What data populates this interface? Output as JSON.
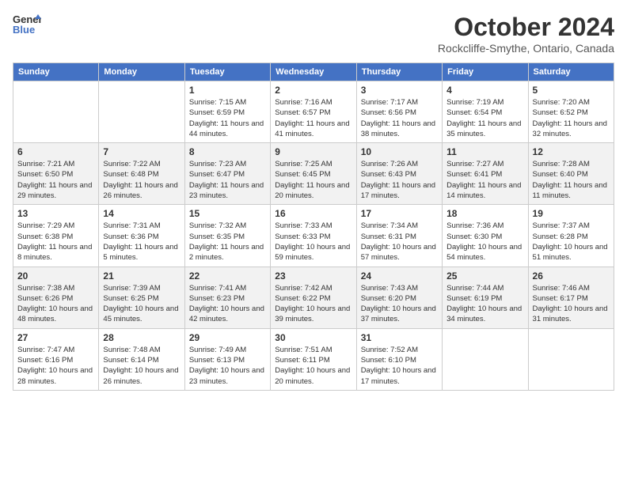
{
  "header": {
    "logo_line1": "General",
    "logo_line2": "Blue",
    "month": "October 2024",
    "location": "Rockcliffe-Smythe, Ontario, Canada"
  },
  "weekdays": [
    "Sunday",
    "Monday",
    "Tuesday",
    "Wednesday",
    "Thursday",
    "Friday",
    "Saturday"
  ],
  "weeks": [
    [
      {
        "day": "",
        "sunrise": "",
        "sunset": "",
        "daylight": ""
      },
      {
        "day": "",
        "sunrise": "",
        "sunset": "",
        "daylight": ""
      },
      {
        "day": "1",
        "sunrise": "Sunrise: 7:15 AM",
        "sunset": "Sunset: 6:59 PM",
        "daylight": "Daylight: 11 hours and 44 minutes."
      },
      {
        "day": "2",
        "sunrise": "Sunrise: 7:16 AM",
        "sunset": "Sunset: 6:57 PM",
        "daylight": "Daylight: 11 hours and 41 minutes."
      },
      {
        "day": "3",
        "sunrise": "Sunrise: 7:17 AM",
        "sunset": "Sunset: 6:56 PM",
        "daylight": "Daylight: 11 hours and 38 minutes."
      },
      {
        "day": "4",
        "sunrise": "Sunrise: 7:19 AM",
        "sunset": "Sunset: 6:54 PM",
        "daylight": "Daylight: 11 hours and 35 minutes."
      },
      {
        "day": "5",
        "sunrise": "Sunrise: 7:20 AM",
        "sunset": "Sunset: 6:52 PM",
        "daylight": "Daylight: 11 hours and 32 minutes."
      }
    ],
    [
      {
        "day": "6",
        "sunrise": "Sunrise: 7:21 AM",
        "sunset": "Sunset: 6:50 PM",
        "daylight": "Daylight: 11 hours and 29 minutes."
      },
      {
        "day": "7",
        "sunrise": "Sunrise: 7:22 AM",
        "sunset": "Sunset: 6:48 PM",
        "daylight": "Daylight: 11 hours and 26 minutes."
      },
      {
        "day": "8",
        "sunrise": "Sunrise: 7:23 AM",
        "sunset": "Sunset: 6:47 PM",
        "daylight": "Daylight: 11 hours and 23 minutes."
      },
      {
        "day": "9",
        "sunrise": "Sunrise: 7:25 AM",
        "sunset": "Sunset: 6:45 PM",
        "daylight": "Daylight: 11 hours and 20 minutes."
      },
      {
        "day": "10",
        "sunrise": "Sunrise: 7:26 AM",
        "sunset": "Sunset: 6:43 PM",
        "daylight": "Daylight: 11 hours and 17 minutes."
      },
      {
        "day": "11",
        "sunrise": "Sunrise: 7:27 AM",
        "sunset": "Sunset: 6:41 PM",
        "daylight": "Daylight: 11 hours and 14 minutes."
      },
      {
        "day": "12",
        "sunrise": "Sunrise: 7:28 AM",
        "sunset": "Sunset: 6:40 PM",
        "daylight": "Daylight: 11 hours and 11 minutes."
      }
    ],
    [
      {
        "day": "13",
        "sunrise": "Sunrise: 7:29 AM",
        "sunset": "Sunset: 6:38 PM",
        "daylight": "Daylight: 11 hours and 8 minutes."
      },
      {
        "day": "14",
        "sunrise": "Sunrise: 7:31 AM",
        "sunset": "Sunset: 6:36 PM",
        "daylight": "Daylight: 11 hours and 5 minutes."
      },
      {
        "day": "15",
        "sunrise": "Sunrise: 7:32 AM",
        "sunset": "Sunset: 6:35 PM",
        "daylight": "Daylight: 11 hours and 2 minutes."
      },
      {
        "day": "16",
        "sunrise": "Sunrise: 7:33 AM",
        "sunset": "Sunset: 6:33 PM",
        "daylight": "Daylight: 10 hours and 59 minutes."
      },
      {
        "day": "17",
        "sunrise": "Sunrise: 7:34 AM",
        "sunset": "Sunset: 6:31 PM",
        "daylight": "Daylight: 10 hours and 57 minutes."
      },
      {
        "day": "18",
        "sunrise": "Sunrise: 7:36 AM",
        "sunset": "Sunset: 6:30 PM",
        "daylight": "Daylight: 10 hours and 54 minutes."
      },
      {
        "day": "19",
        "sunrise": "Sunrise: 7:37 AM",
        "sunset": "Sunset: 6:28 PM",
        "daylight": "Daylight: 10 hours and 51 minutes."
      }
    ],
    [
      {
        "day": "20",
        "sunrise": "Sunrise: 7:38 AM",
        "sunset": "Sunset: 6:26 PM",
        "daylight": "Daylight: 10 hours and 48 minutes."
      },
      {
        "day": "21",
        "sunrise": "Sunrise: 7:39 AM",
        "sunset": "Sunset: 6:25 PM",
        "daylight": "Daylight: 10 hours and 45 minutes."
      },
      {
        "day": "22",
        "sunrise": "Sunrise: 7:41 AM",
        "sunset": "Sunset: 6:23 PM",
        "daylight": "Daylight: 10 hours and 42 minutes."
      },
      {
        "day": "23",
        "sunrise": "Sunrise: 7:42 AM",
        "sunset": "Sunset: 6:22 PM",
        "daylight": "Daylight: 10 hours and 39 minutes."
      },
      {
        "day": "24",
        "sunrise": "Sunrise: 7:43 AM",
        "sunset": "Sunset: 6:20 PM",
        "daylight": "Daylight: 10 hours and 37 minutes."
      },
      {
        "day": "25",
        "sunrise": "Sunrise: 7:44 AM",
        "sunset": "Sunset: 6:19 PM",
        "daylight": "Daylight: 10 hours and 34 minutes."
      },
      {
        "day": "26",
        "sunrise": "Sunrise: 7:46 AM",
        "sunset": "Sunset: 6:17 PM",
        "daylight": "Daylight: 10 hours and 31 minutes."
      }
    ],
    [
      {
        "day": "27",
        "sunrise": "Sunrise: 7:47 AM",
        "sunset": "Sunset: 6:16 PM",
        "daylight": "Daylight: 10 hours and 28 minutes."
      },
      {
        "day": "28",
        "sunrise": "Sunrise: 7:48 AM",
        "sunset": "Sunset: 6:14 PM",
        "daylight": "Daylight: 10 hours and 26 minutes."
      },
      {
        "day": "29",
        "sunrise": "Sunrise: 7:49 AM",
        "sunset": "Sunset: 6:13 PM",
        "daylight": "Daylight: 10 hours and 23 minutes."
      },
      {
        "day": "30",
        "sunrise": "Sunrise: 7:51 AM",
        "sunset": "Sunset: 6:11 PM",
        "daylight": "Daylight: 10 hours and 20 minutes."
      },
      {
        "day": "31",
        "sunrise": "Sunrise: 7:52 AM",
        "sunset": "Sunset: 6:10 PM",
        "daylight": "Daylight: 10 hours and 17 minutes."
      },
      {
        "day": "",
        "sunrise": "",
        "sunset": "",
        "daylight": ""
      },
      {
        "day": "",
        "sunrise": "",
        "sunset": "",
        "daylight": ""
      }
    ]
  ]
}
